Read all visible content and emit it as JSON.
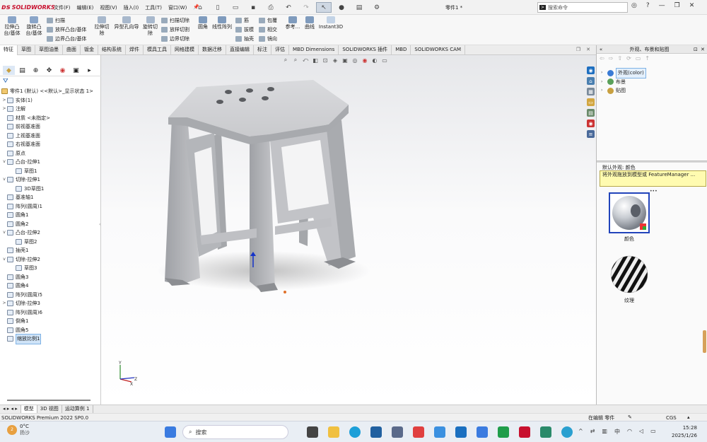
{
  "app": {
    "logo_text": "SOLIDWORKS",
    "document_title": "零件1 *",
    "search_placeholder": "搜索命令"
  },
  "menus": [
    "文件(F)",
    "编辑(E)",
    "视图(V)",
    "插入(I)",
    "工具(T)",
    "窗口(W)"
  ],
  "ribbon": {
    "extrude_boss": "拉伸凸台/基体",
    "revolve_boss": "旋转凸台/基体",
    "sweep": "扫描",
    "loft_boss": "放样凸台/基体",
    "boundary_boss": "边界凸台/基体",
    "extrude_cut": "拉伸切除",
    "hole_wizard": "异型孔向导",
    "revolve_cut": "旋转切除",
    "swept_cut": "扫描切除",
    "lofted_cut": "放样切割",
    "boundary_cut": "边界切除",
    "fillet": "圆角",
    "linear_pattern": "线性阵列",
    "rib": "筋",
    "draft": "拔模",
    "shell": "抽壳",
    "wrap": "包覆",
    "intersect": "相交",
    "mirror": "镜向",
    "reference": "参考...",
    "curves": "曲线",
    "instant3d": "Instant3D"
  },
  "command_tabs": [
    "特征",
    "草图",
    "草图油墨",
    "曲面",
    "钣金",
    "结构系统",
    "焊件",
    "模具工具",
    "网格建模",
    "数据迁移",
    "直接编辑",
    "标注",
    "评估",
    "MBD Dimensions",
    "SOLIDWORKS 插件",
    "MBD",
    "SOLIDWORKS CAM"
  ],
  "tree": {
    "root": "零件1 (默认) <<默认>_显示状态 1>",
    "items": [
      {
        "label": "实体(1)",
        "expand": ">",
        "indent": 0
      },
      {
        "label": "注解",
        "expand": ">",
        "indent": 0
      },
      {
        "label": "材质 <未指定>",
        "expand": "",
        "indent": 0
      },
      {
        "label": "前视基准面",
        "expand": "",
        "indent": 0
      },
      {
        "label": "上视基准面",
        "expand": "",
        "indent": 0
      },
      {
        "label": "右视基准面",
        "expand": "",
        "indent": 0
      },
      {
        "label": "原点",
        "expand": "",
        "indent": 0
      },
      {
        "label": "凸台-拉伸1",
        "expand": "v",
        "indent": 0
      },
      {
        "label": "草图1",
        "expand": "",
        "indent": 1
      },
      {
        "label": "切除-拉伸1",
        "expand": "v",
        "indent": 0
      },
      {
        "label": "3D草图1",
        "expand": "",
        "indent": 1
      },
      {
        "label": "基准轴1",
        "expand": "",
        "indent": 0
      },
      {
        "label": "阵列(圆周)1",
        "expand": "",
        "indent": 0
      },
      {
        "label": "圆角1",
        "expand": "",
        "indent": 0
      },
      {
        "label": "圆角2",
        "expand": "",
        "indent": 0
      },
      {
        "label": "凸台-拉伸2",
        "expand": "v",
        "indent": 0
      },
      {
        "label": "草图2",
        "expand": "",
        "indent": 1
      },
      {
        "label": "抽壳1",
        "expand": "",
        "indent": 0
      },
      {
        "label": "切除-拉伸2",
        "expand": "v",
        "indent": 0
      },
      {
        "label": "草图3",
        "expand": "",
        "indent": 1
      },
      {
        "label": "圆角3",
        "expand": "",
        "indent": 0
      },
      {
        "label": "圆角4",
        "expand": "",
        "indent": 0
      },
      {
        "label": "阵列(圆周)5",
        "expand": "",
        "indent": 0
      },
      {
        "label": "切除-拉伸3",
        "expand": ">",
        "indent": 0
      },
      {
        "label": "阵列(圆周)6",
        "expand": "",
        "indent": 0
      },
      {
        "label": "倒角1",
        "expand": "",
        "indent": 0
      },
      {
        "label": "圆角5",
        "expand": "",
        "indent": 0
      },
      {
        "label": "缩放比例1",
        "expand": "",
        "indent": 0,
        "highlight": true
      }
    ]
  },
  "taskpane": {
    "title": "外观、布景和贴图",
    "tree": [
      {
        "label": "外观(color)",
        "highlight": true,
        "color": "#3a7bd5"
      },
      {
        "label": "布景",
        "highlight": false,
        "color": "#5aa05a"
      },
      {
        "label": "贴图",
        "highlight": false,
        "color": "#c8a040"
      }
    ],
    "section_title": "默认外观: 颜色",
    "tip": "将外观拖放到模型或 FeatureManager ...",
    "swatches": [
      {
        "label": "颜色"
      },
      {
        "label": "纹理"
      }
    ]
  },
  "bottom_tabs": [
    "模型",
    "3D 视图",
    "运动算例 1"
  ],
  "status": {
    "left": "SOLIDWORKS Premium 2022 SP0.0",
    "edit_state": "在编辑 零件",
    "units": "CGS"
  },
  "taskbar": {
    "temperature": "0°C",
    "weather": "扬沙",
    "search": "搜索",
    "tray_lang": "中",
    "time": "15:28",
    "date": "2025/1/26"
  },
  "triad": {
    "y": "Y",
    "x": "X",
    "z": "Z"
  },
  "colors": {
    "accent": "#c8102e",
    "selection": "#2244bb",
    "tooltip": "#fffbb0"
  }
}
